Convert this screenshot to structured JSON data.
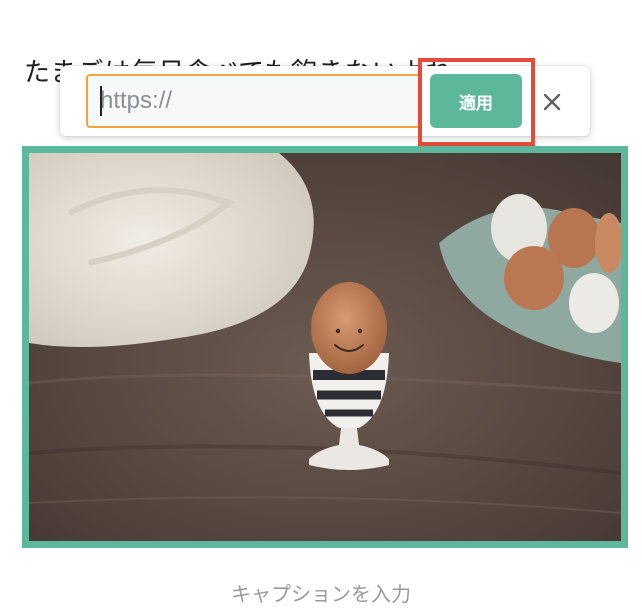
{
  "body": {
    "text": "たまごは毎日食べても飽きないよね"
  },
  "link_popover": {
    "url_placeholder": "https://",
    "url_value": "",
    "apply_label": "適用",
    "close_icon": "close-icon"
  },
  "image": {
    "alt": "卵とエッグスタンド",
    "caption_placeholder": "キャプションを入力"
  },
  "colors": {
    "accent": "#5db79a",
    "input_focus": "#f0a53a",
    "highlight": "#e54b3a"
  }
}
